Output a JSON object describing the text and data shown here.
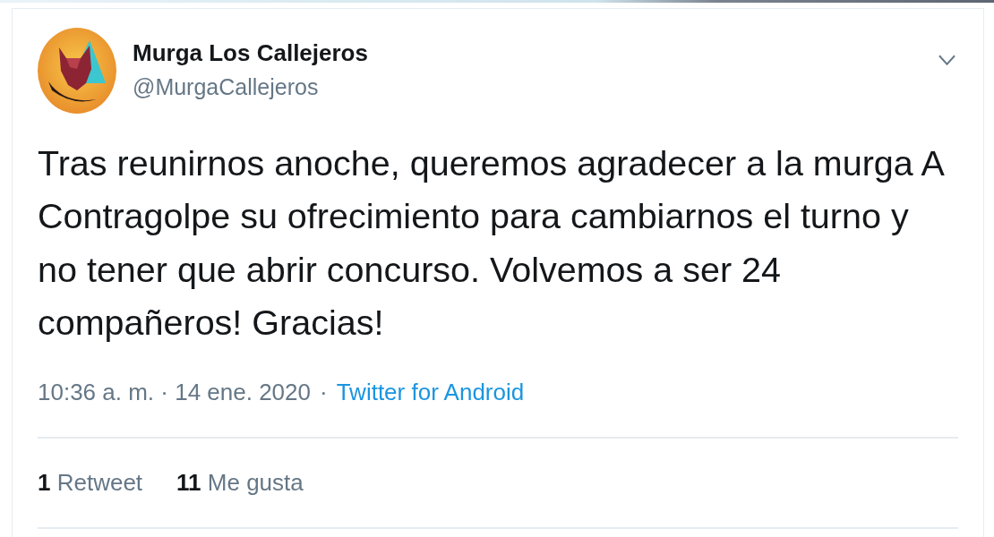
{
  "tweet": {
    "author": {
      "name": "Murga Los Callejeros",
      "handle": "@MurgaCallejeros"
    },
    "text": "Tras reunirnos anoche, queremos agradecer a la murga A Contragolpe su ofrecimiento para cambiarnos el turno y no tener que abrir concurso. Volvemos a ser 24 compañeros! Gracias!",
    "meta": {
      "timestamp": "10:36 a. m. · 14 ene. 2020",
      "separator": "·",
      "source": "Twitter for Android"
    },
    "stats": [
      {
        "count": "1",
        "label": "Retweet"
      },
      {
        "count": "11",
        "label": "Me gusta"
      }
    ]
  }
}
